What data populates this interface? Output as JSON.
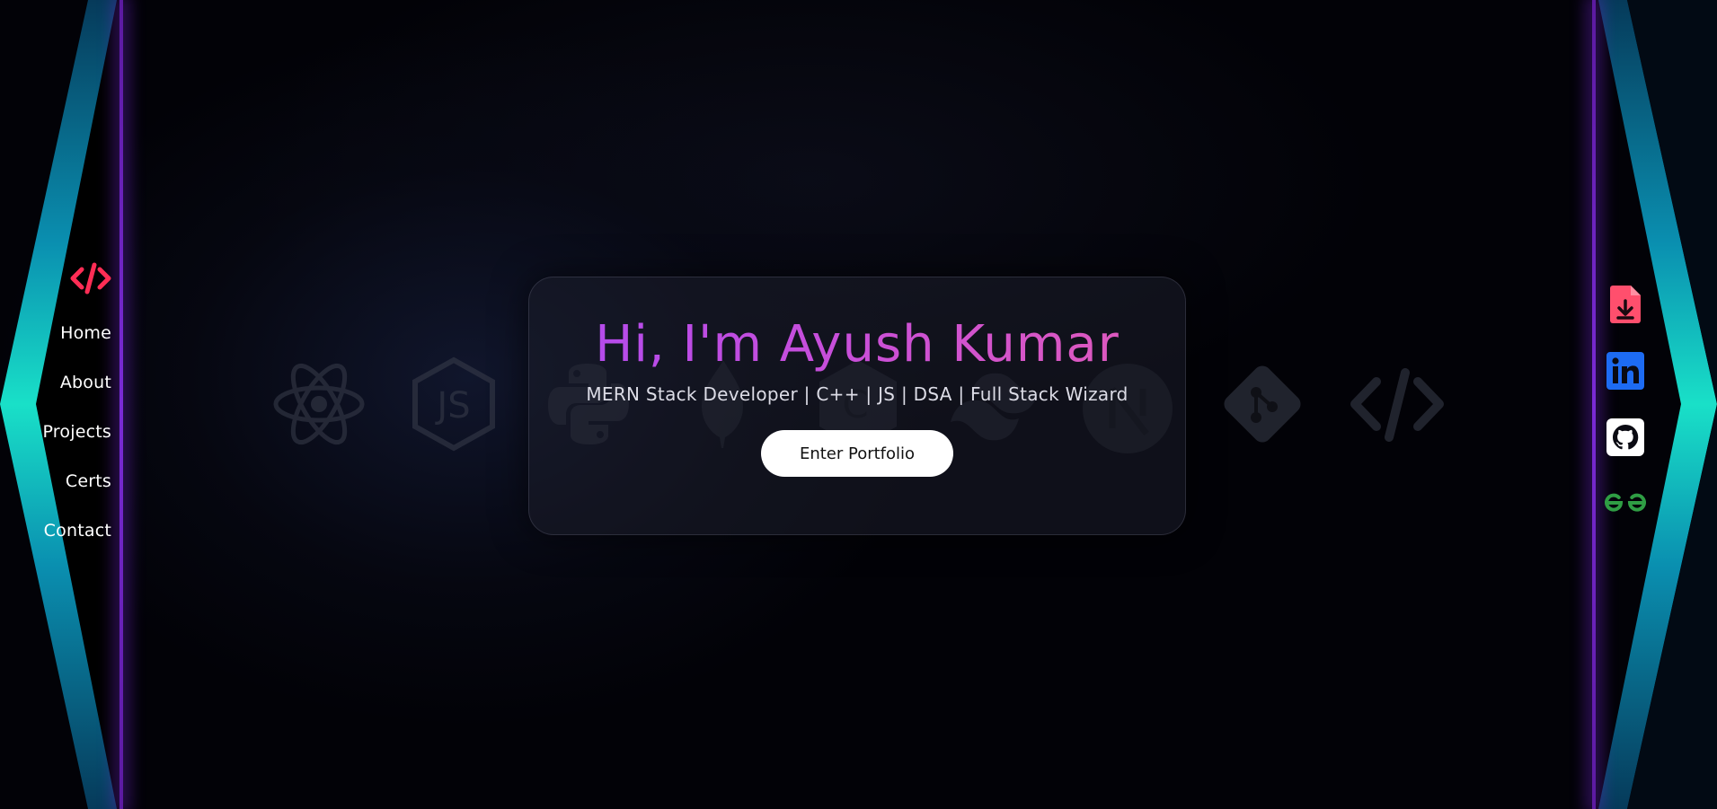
{
  "nav": {
    "logo_icon": "code-tag-icon",
    "items": [
      {
        "label": "Home"
      },
      {
        "label": "About"
      },
      {
        "label": "Projects"
      },
      {
        "label": "Certs"
      },
      {
        "label": "Contact"
      }
    ]
  },
  "hero": {
    "headline": "Hi, I'm Ayush Kumar",
    "tagline": "MERN Stack Developer | C++ | JS | DSA | Full Stack Wizard",
    "cta_label": "Enter Portfolio"
  },
  "social": [
    {
      "icon": "resume-download-icon",
      "color": "#ff4f6d"
    },
    {
      "icon": "linkedin-icon",
      "color": "#1d6bf2"
    },
    {
      "icon": "github-icon",
      "color": "#ffffff"
    },
    {
      "icon": "geeksforgeeks-icon",
      "color": "#2f9e44"
    }
  ],
  "tech_icons": [
    "react-icon",
    "nodejs-icon",
    "python-icon",
    "mongodb-icon",
    "cplusplus-icon",
    "tailwind-icon",
    "nextjs-icon",
    "git-icon",
    "code-icon"
  ],
  "colors": {
    "accent_cyan": "#19d3c5",
    "accent_purple": "#7a2bd6",
    "headline_gradient_start": "#b14af0",
    "headline_gradient_end": "#e25bb8",
    "logo_red": "#ff2d55"
  }
}
